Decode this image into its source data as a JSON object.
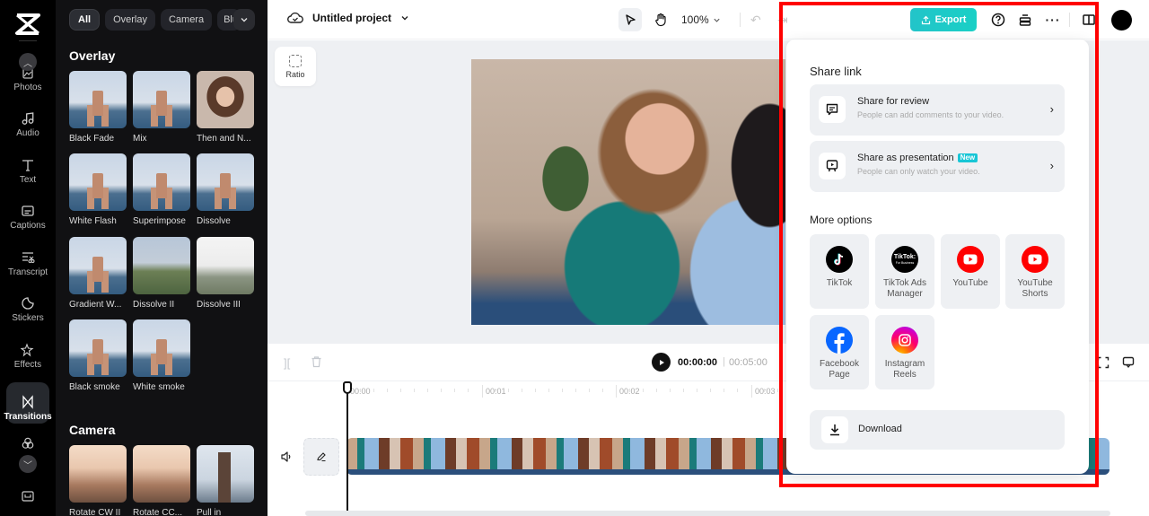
{
  "rail": {
    "items": [
      {
        "label": "Photos",
        "icon": "photo-icon"
      },
      {
        "label": "Audio",
        "icon": "music-note-icon"
      },
      {
        "label": "Text",
        "icon": "text-icon"
      },
      {
        "label": "Captions",
        "icon": "captions-icon"
      },
      {
        "label": "Transcript",
        "icon": "transcript-icon"
      },
      {
        "label": "Stickers",
        "icon": "sticker-icon"
      },
      {
        "label": "Effects",
        "icon": "sparkle-icon"
      },
      {
        "label": "Transitions",
        "icon": "transition-icon",
        "active": true
      }
    ]
  },
  "panel": {
    "chips": [
      "All",
      "Overlay",
      "Camera",
      "Blu"
    ],
    "sections": [
      {
        "title": "Overlay",
        "items": [
          "Black Fade",
          "Mix",
          "Then and N...",
          "White Flash",
          "Superimpose",
          "Dissolve",
          "Gradient W...",
          "Dissolve II",
          "Dissolve III",
          "Black smoke",
          "White smoke"
        ]
      },
      {
        "title": "Camera",
        "items": [
          "Rotate CW II",
          "Rotate CC...",
          "Pull in"
        ]
      }
    ]
  },
  "topbar": {
    "project_title": "Untitled project",
    "zoom_level": "100%",
    "export_label": "Export"
  },
  "canvas": {
    "ratio_label": "Ratio"
  },
  "timeline": {
    "current_time": "00:00:00",
    "separator": "|",
    "total_time": "00:05:00",
    "ruler": [
      "00:00",
      "00:01",
      "00:02",
      "00:03"
    ]
  },
  "export_menu": {
    "share_link_heading": "Share link",
    "share_review": {
      "title": "Share for review",
      "subtitle": "People can add comments to your video."
    },
    "share_presentation": {
      "title": "Share as presentation",
      "badge": "New",
      "subtitle": "People can only watch your video."
    },
    "more_options_heading": "More options",
    "options": [
      {
        "label": "TikTok",
        "color": "#000000"
      },
      {
        "label": "TikTok Ads Manager",
        "color": "#000000"
      },
      {
        "label": "YouTube",
        "color": "#ff0000"
      },
      {
        "label": "YouTube Shorts",
        "color": "#ff0000"
      },
      {
        "label": "Facebook Page",
        "color": "#0866ff"
      },
      {
        "label": "Instagram Reels",
        "color": "#e1306c"
      }
    ],
    "download_label": "Download",
    "tiktok_ads_badge": "TikTok:",
    "tiktok_ads_sub": "For Business"
  },
  "colors": {
    "accent": "#1ecbc8",
    "highlight": "#ff0000"
  }
}
